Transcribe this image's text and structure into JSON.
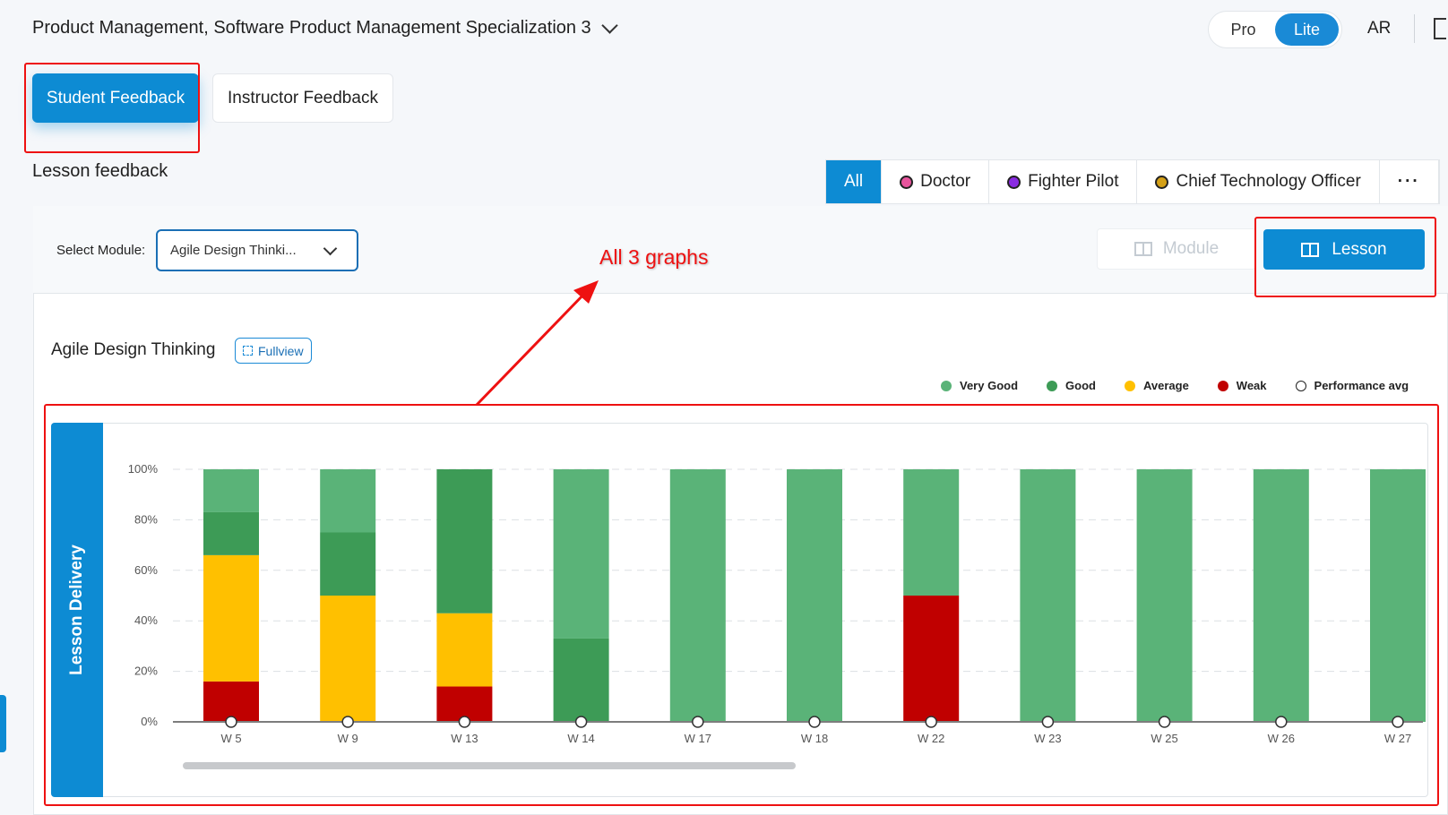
{
  "header": {
    "course_title": "Product Management, Software Product Management Specialization 3",
    "mode_pro": "Pro",
    "mode_lite": "Lite",
    "language": "AR"
  },
  "feedback_tabs": {
    "student": "Student Feedback",
    "instructor": "Instructor Feedback"
  },
  "section_label": "Lesson feedback",
  "persona_filter": {
    "all": "All",
    "items": [
      {
        "label": "Doctor",
        "color": "#e8559d"
      },
      {
        "label": "Fighter Pilot",
        "color": "#8a2be2"
      },
      {
        "label": "Chief Technology Officer",
        "color": "#d4a017"
      }
    ],
    "more": "···"
  },
  "controls": {
    "select_module_label": "Select Module:",
    "module_value": "Agile Design Thinki...",
    "view_module": "Module",
    "view_lesson": "Lesson"
  },
  "annotation": {
    "text": "All 3 graphs"
  },
  "chart_header": {
    "title": "Agile Design Thinking",
    "fullview": "Fullview"
  },
  "chart_data": {
    "type": "bar",
    "stacked": true,
    "side_label": "Lesson Delivery",
    "categories": [
      "W 5",
      "W 9",
      "W 13",
      "W 14",
      "W 17",
      "W 18",
      "W 22",
      "W 23",
      "W 25",
      "W 26",
      "W 27"
    ],
    "yticks": [
      "0%",
      "20%",
      "40%",
      "60%",
      "80%",
      "100%"
    ],
    "ylim": [
      0,
      100
    ],
    "series": [
      {
        "name": "Weak",
        "color": "#c00000",
        "values": [
          16,
          0,
          14,
          0,
          0,
          0,
          50,
          0,
          0,
          0,
          0
        ]
      },
      {
        "name": "Average",
        "color": "#ffc000",
        "values": [
          50,
          50,
          29,
          0,
          0,
          0,
          0,
          0,
          0,
          0,
          0
        ]
      },
      {
        "name": "Good",
        "color": "#3d9b56",
        "values": [
          17,
          25,
          57,
          33,
          0,
          0,
          0,
          0,
          0,
          0,
          0
        ]
      },
      {
        "name": "Very Good",
        "color": "#5ab378",
        "values": [
          17,
          25,
          0,
          67,
          100,
          100,
          50,
          100,
          100,
          100,
          100
        ]
      }
    ],
    "performance_avg": {
      "name": "Performance avg",
      "values": [
        0,
        0,
        0,
        0,
        0,
        0,
        0,
        0,
        0,
        0,
        0
      ]
    },
    "legend": [
      {
        "name": "Very Good",
        "color": "#5ab378"
      },
      {
        "name": "Good",
        "color": "#3d9b56"
      },
      {
        "name": "Average",
        "color": "#ffc000"
      },
      {
        "name": "Weak",
        "color": "#c00000"
      },
      {
        "name": "Performance avg",
        "color": "#ffffff"
      }
    ],
    "grid": true,
    "legend_position": "top-right"
  }
}
